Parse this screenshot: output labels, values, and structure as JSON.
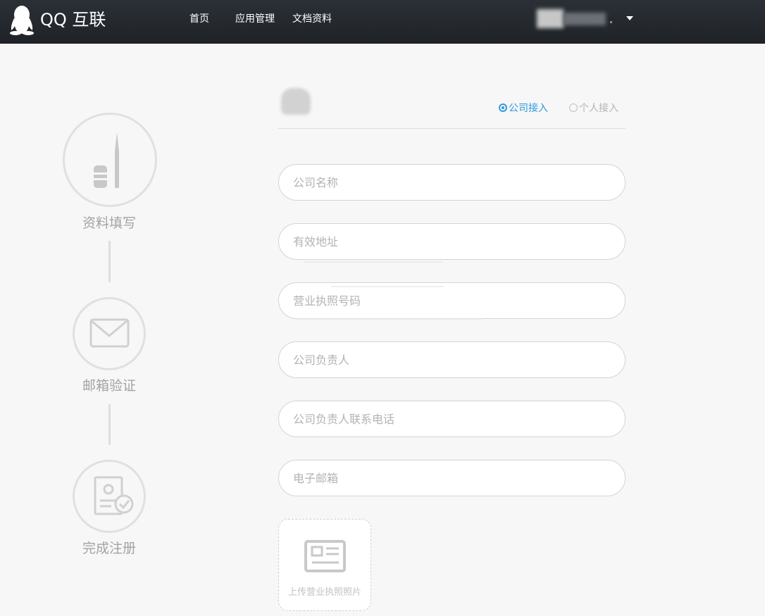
{
  "header": {
    "brand": "QQ 互联",
    "nav": [
      "首页",
      "应用管理",
      "文档资料"
    ]
  },
  "steps": [
    {
      "label": "资料填写",
      "icon": "pencil-icon"
    },
    {
      "label": "邮箱验证",
      "icon": "envelope-icon"
    },
    {
      "label": "完成注册",
      "icon": "certificate-check-icon"
    }
  ],
  "access_type": {
    "options": [
      "公司接入",
      "个人接入"
    ],
    "selected": "公司接入"
  },
  "form": {
    "fields": [
      {
        "placeholder": "公司名称"
      },
      {
        "placeholder": "有效地址"
      },
      {
        "placeholder": "营业执照号码"
      },
      {
        "placeholder": "公司负责人"
      },
      {
        "placeholder": "公司负责人联系电话"
      },
      {
        "placeholder": "电子邮箱"
      }
    ],
    "upload_label": "上传营业执照照片"
  },
  "colors": {
    "header_bg": "#24292e",
    "accent": "#2e9ae0",
    "page_bg": "#f7f7f7",
    "muted": "#a3a3a3"
  }
}
